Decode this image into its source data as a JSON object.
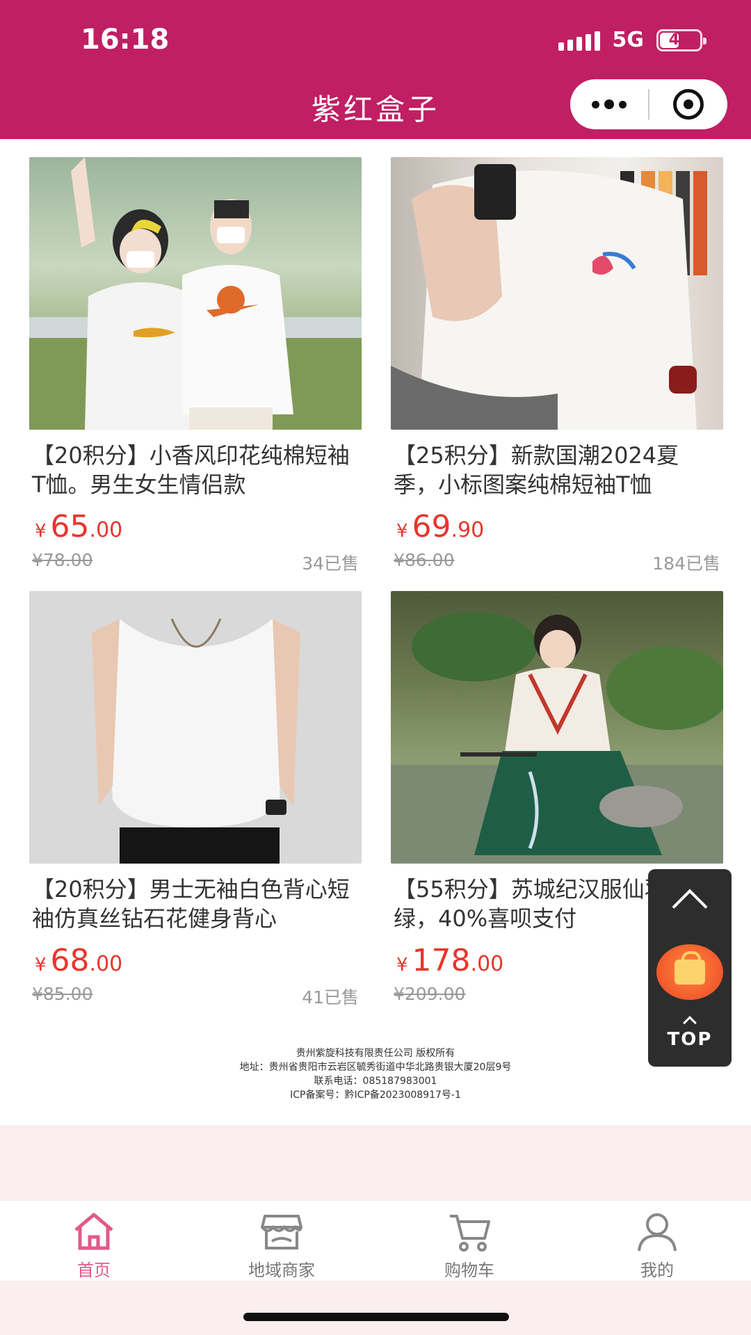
{
  "status_bar": {
    "time": "16:18",
    "network": "5G",
    "battery": "49",
    "battery_level": 0.49
  },
  "header": {
    "title": "紫红盒子",
    "accent_color": "#c01f63"
  },
  "products": [
    {
      "name": "【20积分】小香风印花纯棉短袖T恤。男生女生情侣款",
      "price_currency": "¥",
      "price_int": "65",
      "price_dec": ".00",
      "original_price": "¥78.00",
      "sold": "34已售"
    },
    {
      "name": "【25积分】新款国潮2024夏季，小标图案纯棉短袖T恤",
      "price_currency": "¥",
      "price_int": "69",
      "price_dec": ".90",
      "original_price": "¥86.00",
      "sold": "184已售"
    },
    {
      "name": "【20积分】男士无袖白色背心短袖仿真丝钻石花健身背心",
      "price_currency": "¥",
      "price_int": "68",
      "price_dec": ".00",
      "original_price": "¥85.00",
      "sold": "41已售"
    },
    {
      "name": "【55积分】苏城纪汉服仙羽深绿，40%喜呗支付",
      "price_currency": "¥",
      "price_int": "178",
      "price_dec": ".00",
      "original_price": "¥209.00",
      "sold": ""
    }
  ],
  "footer": {
    "company": "贵州紫旋科技有限责任公司 版权所有",
    "address": "地址：贵州省贵阳市云岩区毓秀街道中华北路贵银大厦20层9号",
    "phone": "联系电话：085187983001",
    "icp": "ICP备案号：黔ICP备2023008917号-1"
  },
  "float_bar": {
    "top_label": "TOP"
  },
  "tabbar": {
    "items": [
      {
        "label": "首页",
        "icon": "home-icon",
        "active": true
      },
      {
        "label": "地域商家",
        "icon": "store-icon",
        "active": false
      },
      {
        "label": "购物车",
        "icon": "cart-icon",
        "active": false
      },
      {
        "label": "我的",
        "icon": "user-icon",
        "active": false
      }
    ],
    "active_color": "#e15a86",
    "inactive_color": "#777777"
  }
}
